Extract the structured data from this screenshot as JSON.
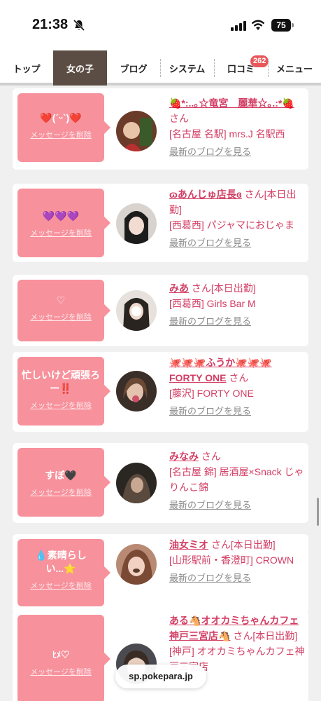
{
  "status": {
    "time": "21:38",
    "battery": "75",
    "icons": [
      "bell-muted-icon",
      "signal-icon",
      "wifi-icon",
      "battery-icon"
    ]
  },
  "nav": {
    "tabs": [
      {
        "label": "トップ"
      },
      {
        "label": "女の子"
      },
      {
        "label": "ブログ"
      },
      {
        "label": "システム"
      },
      {
        "label": "口コミ",
        "badge": "262"
      },
      {
        "label": "メニュー"
      }
    ]
  },
  "delete_label": "メッセージを削除",
  "blog_label": "最新のブログを見る",
  "san": "さん",
  "cards": [
    {
      "message": "❤️(´ᵕ`)❤️",
      "name": "🍓*:..｡☆竜宮　麗華☆｡.:*🍓",
      "suffix": "",
      "shop": "[名古屋 名駅] mrs.J 名駅西"
    },
    {
      "message": "💜💜💜",
      "name": "ɷあんじゅ店長ɞ",
      "suffix": "[本日出勤]",
      "shop": "[西葛西] パジャマにおじゃま"
    },
    {
      "message": "♡",
      "name": "みあ",
      "suffix": "[本日出勤]",
      "shop": "[西葛西] Girls Bar M"
    },
    {
      "message": "忙しいけど頑張ろー‼️",
      "name": "🐙🐙🐙ふうか🐙🐙🐙FORTY ONE",
      "suffix": "",
      "shop": "[藤沢] FORTY ONE"
    },
    {
      "message": "すぼ🖤",
      "name": "みなみ",
      "suffix": "",
      "shop": "[名古屋 錦] 居酒屋×Snack じゃりんこ錦"
    },
    {
      "message": "💧素晴らしい...⭐️",
      "name": "油女ミオ",
      "suffix": "[本日出勤]",
      "shop": "[山形駅前・香澄町] CROWN"
    },
    {
      "message": "ﾋﾒ♡",
      "name": "ある🐴オオカミちゃんカフェ神戸三宮店🐴",
      "suffix": "[本日出勤]",
      "shop": "[神戸] オオカミちゃんカフェ神戸三宮店"
    }
  ],
  "url": "sp.pokepara.jp",
  "colors": {
    "accent": "#d23d63",
    "bubble": "#f7919c",
    "active_tab": "#5b4d43",
    "badge": "#e8585b"
  }
}
